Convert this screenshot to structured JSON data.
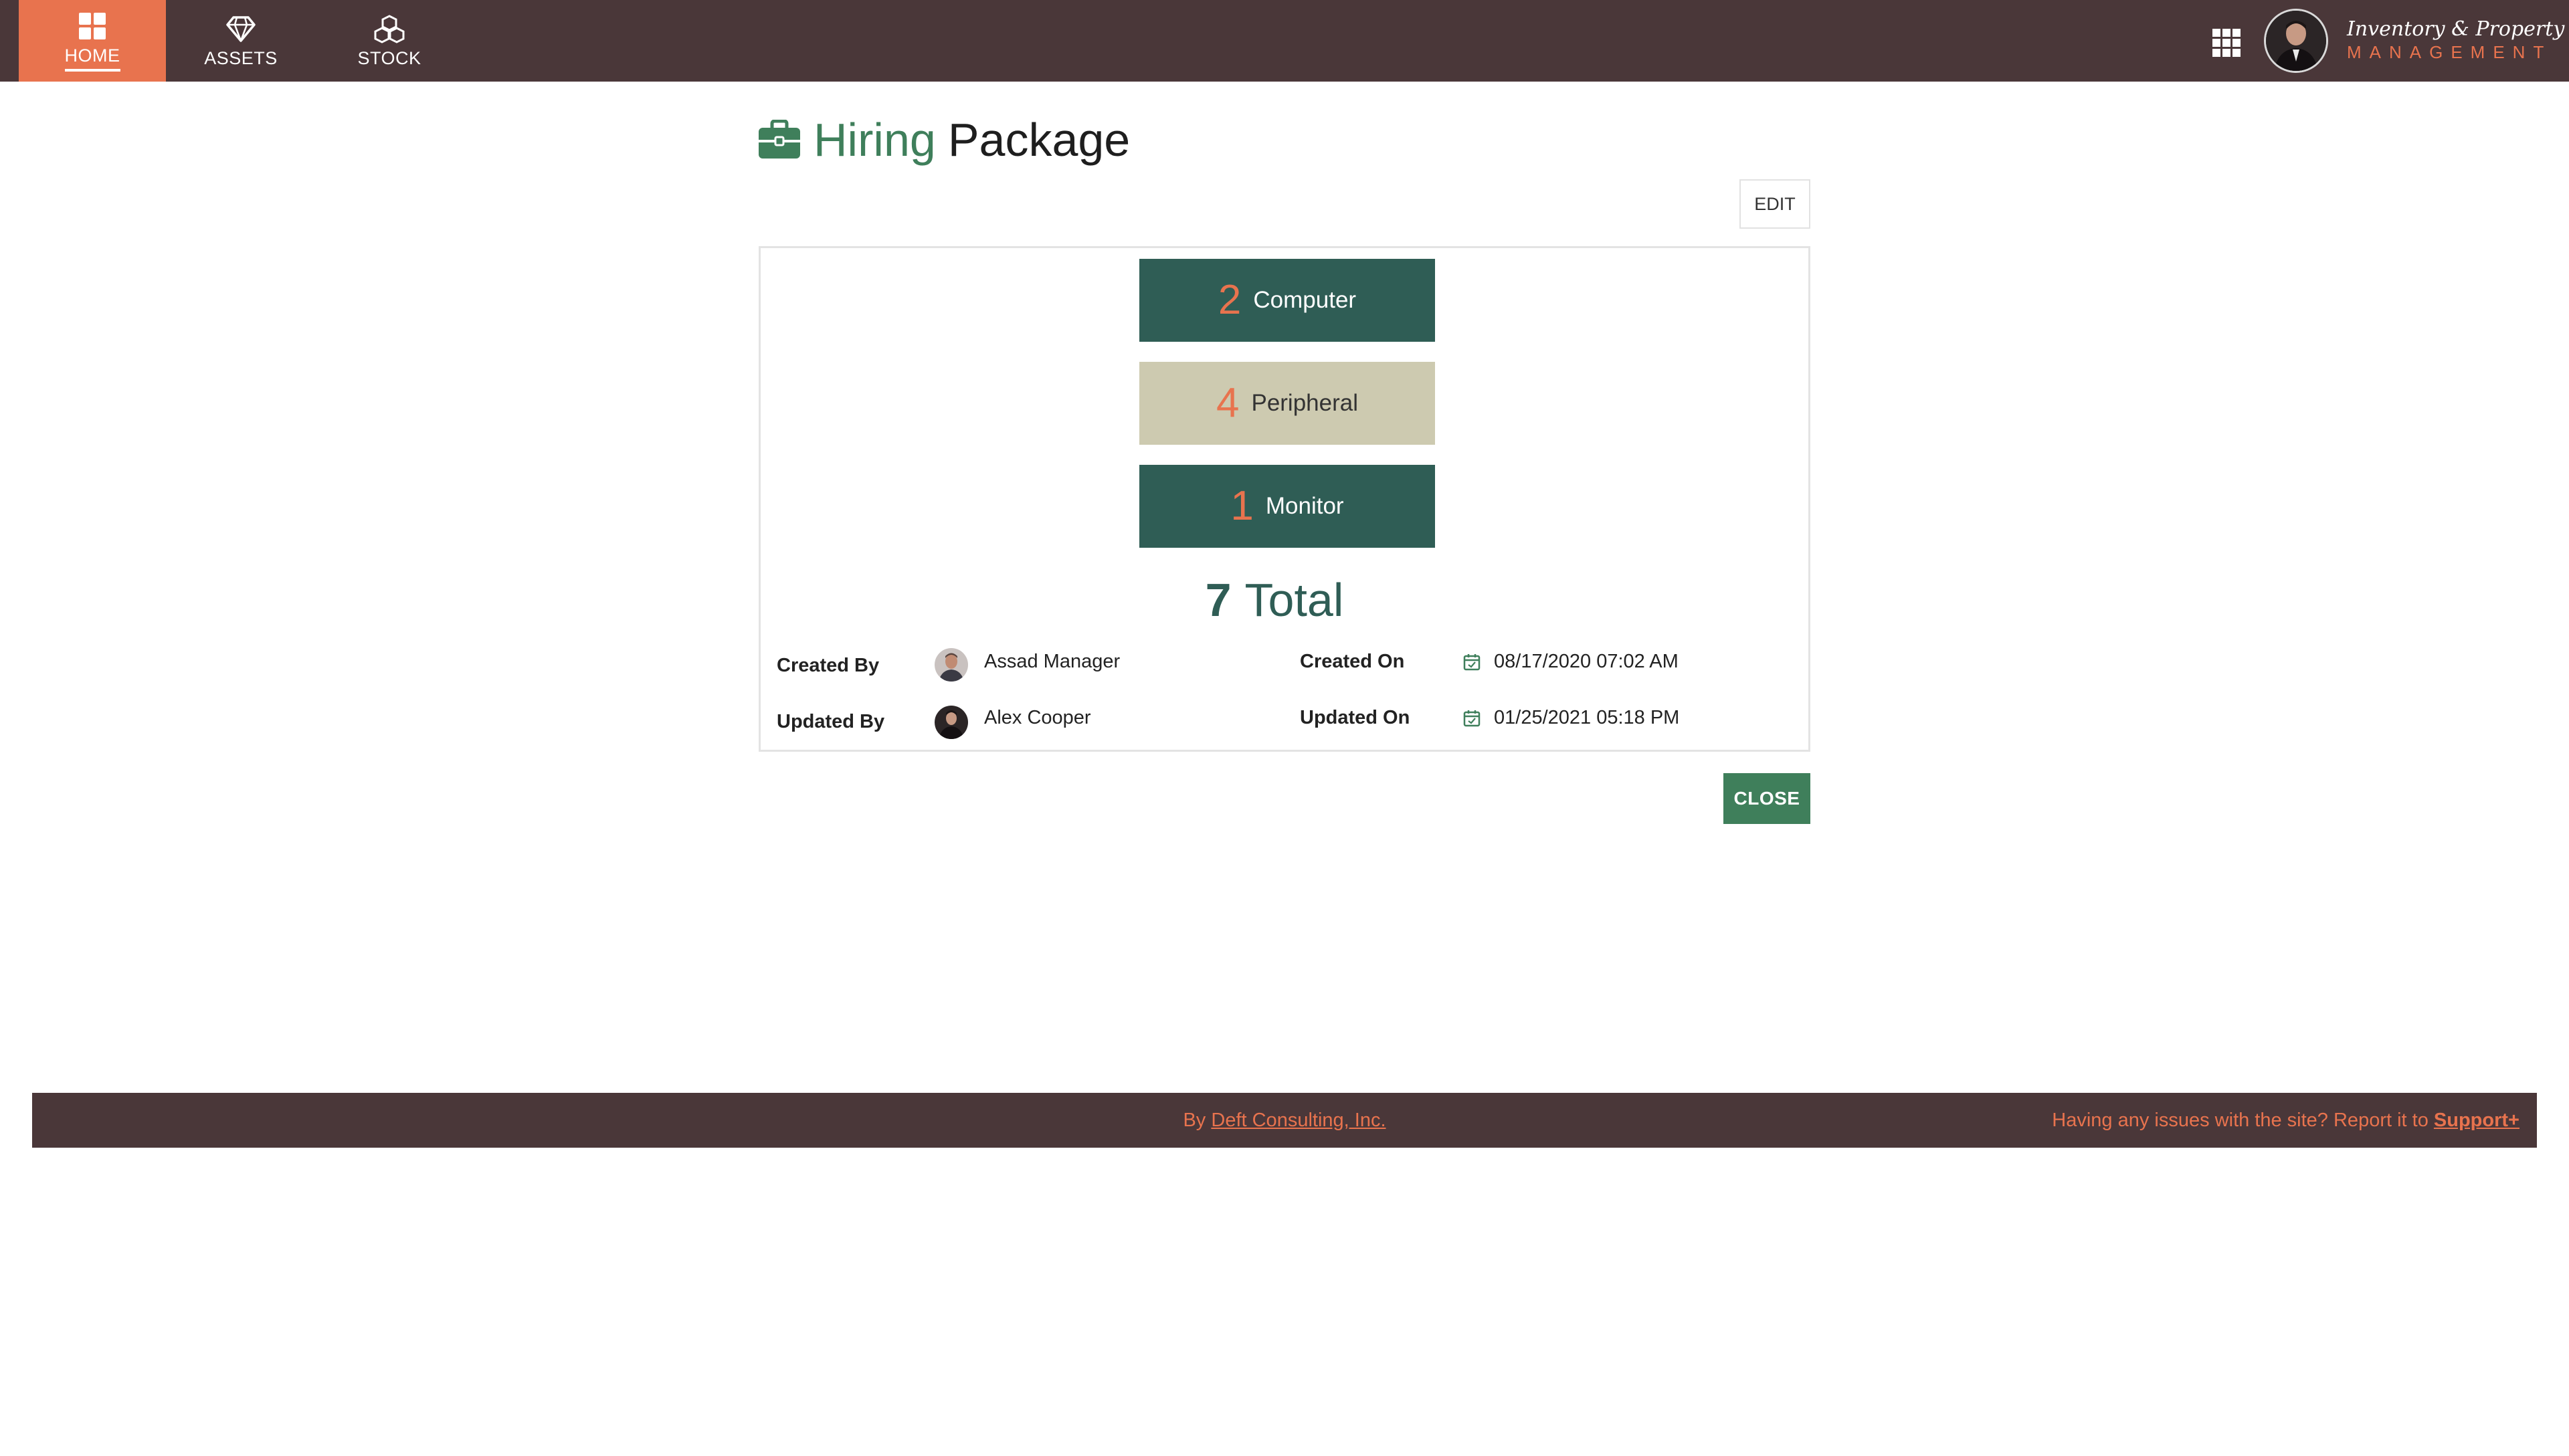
{
  "nav": {
    "items": [
      {
        "label": "HOME",
        "icon": "dashboard-grid-icon",
        "active": true
      },
      {
        "label": "ASSETS",
        "icon": "diamond-icon",
        "active": false
      },
      {
        "label": "STOCK",
        "icon": "boxes-stack-icon",
        "active": false
      }
    ],
    "brand_line1": "Inventory & Property",
    "brand_line2": "MANAGEMENT",
    "apps_icon": "apps-grid-icon"
  },
  "page": {
    "title_icon": "briefcase-icon",
    "title_accent": "Hiring",
    "title_main": "Package",
    "edit_label": "EDIT",
    "close_label": "CLOSE"
  },
  "package": {
    "items": [
      {
        "quantity": "2",
        "category": "Computer"
      },
      {
        "quantity": "4",
        "category": "Peripheral"
      },
      {
        "quantity": "1",
        "category": "Monitor"
      }
    ],
    "total_number": "7",
    "total_label": "Total"
  },
  "meta": {
    "created_by_label": "Created By",
    "created_by": "Assad Manager",
    "updated_by_label": "Updated By",
    "updated_by": "Alex Cooper",
    "created_on_label": "Created On",
    "created_on": "08/17/2020 07:02 AM",
    "updated_on_label": "Updated On",
    "updated_on": "01/25/2021 05:18 PM",
    "calendar_icon": "calendar-check-icon"
  },
  "footer": {
    "credit_prefix": "By ",
    "credit_link": "Deft Consulting, Inc.",
    "support_text": "Having any issues with the site? Report it to ",
    "support_link": "Support+"
  },
  "colors": {
    "topbar": "#4a3739",
    "accent_orange": "#e8734e",
    "dark_teal": "#2f5d55",
    "khaki": "#cdcab0",
    "green": "#3f7f5b"
  }
}
